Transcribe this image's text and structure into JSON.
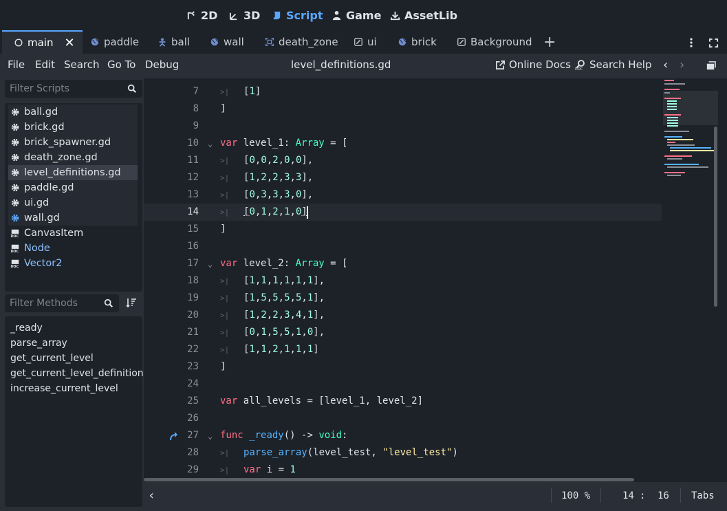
{
  "workspaces": [
    {
      "label": "2D",
      "icon": "2d-icon"
    },
    {
      "label": "3D",
      "icon": "3d-icon"
    },
    {
      "label": "Script",
      "icon": "script-icon"
    },
    {
      "label": "Game",
      "icon": "game-icon"
    },
    {
      "label": "AssetLib",
      "icon": "assetlib-icon"
    }
  ],
  "tabs": [
    {
      "label": "main",
      "icon": "node-circle-icon"
    },
    {
      "label": "paddle",
      "icon": "globe-icon"
    },
    {
      "label": "ball",
      "icon": "body-icon"
    },
    {
      "label": "wall",
      "icon": "globe-icon"
    },
    {
      "label": "death_zone",
      "icon": "area-icon"
    },
    {
      "label": "ui",
      "icon": "edit-icon"
    },
    {
      "label": "brick",
      "icon": "globe-icon"
    },
    {
      "label": "Background",
      "icon": "edit-icon"
    }
  ],
  "menu": {
    "items": [
      "File",
      "Edit",
      "Search",
      "Go To",
      "Debug"
    ],
    "file_title": "level_definitions.gd",
    "online_docs": "Online Docs",
    "search_help": "Search Help"
  },
  "sidebar": {
    "filter_scripts_placeholder": "Filter Scripts",
    "scripts": [
      {
        "label": "ball.gd",
        "kind": "gear"
      },
      {
        "label": "brick.gd",
        "kind": "gear"
      },
      {
        "label": "brick_spawner.gd",
        "kind": "gear"
      },
      {
        "label": "death_zone.gd",
        "kind": "gear"
      },
      {
        "label": "level_definitions.gd",
        "kind": "gear"
      },
      {
        "label": "paddle.gd",
        "kind": "gear"
      },
      {
        "label": "ui.gd",
        "kind": "gear"
      },
      {
        "label": "wall.gd",
        "kind": "gear-blue"
      },
      {
        "label": "CanvasItem",
        "kind": "doc"
      },
      {
        "label": "Node",
        "kind": "doc-link"
      },
      {
        "label": "Vector2",
        "kind": "doc-link"
      }
    ],
    "filter_methods_placeholder": "Filter Methods",
    "methods": [
      "_ready",
      "parse_array",
      "get_current_level",
      "get_current_level_definition",
      "increase_current_level"
    ]
  },
  "editor": {
    "current_line": 14,
    "lines": [
      {
        "n": "7",
        "code": "[1]",
        "indent": 1
      },
      {
        "n": "8",
        "code": "]",
        "indent": 0
      },
      {
        "n": "9",
        "code": "",
        "indent": 0
      },
      {
        "n": "10",
        "code": "var level_1: Array = [",
        "indent": 0,
        "fold": true
      },
      {
        "n": "11",
        "code": "[0,0,2,0,0],",
        "indent": 1
      },
      {
        "n": "12",
        "code": "[1,2,2,3,3],",
        "indent": 1
      },
      {
        "n": "13",
        "code": "[0,3,3,3,0],",
        "indent": 1
      },
      {
        "n": "14",
        "code": "[0,1,2,1,0]",
        "indent": 1
      },
      {
        "n": "15",
        "code": "]",
        "indent": 0
      },
      {
        "n": "16",
        "code": "",
        "indent": 0
      },
      {
        "n": "17",
        "code": "var level_2: Array = [",
        "indent": 0,
        "fold": true
      },
      {
        "n": "18",
        "code": "[1,1,1,1,1,1],",
        "indent": 1
      },
      {
        "n": "19",
        "code": "[1,5,5,5,5,1],",
        "indent": 1
      },
      {
        "n": "20",
        "code": "[1,2,2,3,4,1],",
        "indent": 1
      },
      {
        "n": "21",
        "code": "[0,1,5,5,1,0],",
        "indent": 1
      },
      {
        "n": "22",
        "code": "[1,1,2,1,1,1]",
        "indent": 1
      },
      {
        "n": "23",
        "code": "]",
        "indent": 0
      },
      {
        "n": "24",
        "code": "",
        "indent": 0
      },
      {
        "n": "25",
        "code": "var all_levels = [level_1, level_2]",
        "indent": 0
      },
      {
        "n": "26",
        "code": "",
        "indent": 0
      },
      {
        "n": "27",
        "code": "func _ready() -> void:",
        "indent": 0,
        "fold": true,
        "override": true
      },
      {
        "n": "28",
        "code": "parse_array(level_test, \"level_test\")",
        "indent": 1
      },
      {
        "n": "29",
        "code": "var i = 1",
        "indent": 1
      }
    ]
  },
  "status": {
    "zoom": "100 %",
    "line": "14",
    "col": "16",
    "indent_mode": "Tabs"
  },
  "colors": {
    "accent": "#5aa7ff",
    "keyword": "#ff7085",
    "type": "#42ffc2",
    "number": "#a1ffe0",
    "function": "#57b3ff",
    "string": "#ffeda1"
  }
}
